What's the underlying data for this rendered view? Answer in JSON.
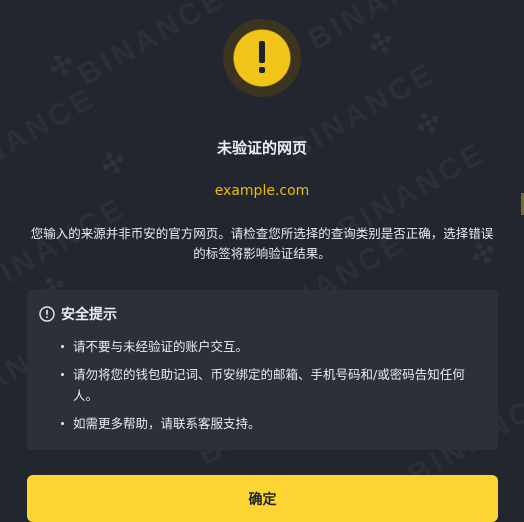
{
  "dialog": {
    "title": "未验证的网页",
    "domain": "example.com",
    "description": "您输入的来源并非币安的官方网页。请检查您所选择的查询类别是否正确，选择错误的标签将影响验证结果。",
    "tips": {
      "heading": "安全提示",
      "items": [
        "请不要与未经验证的账户交互。",
        "请勿将您的钱包助记词、币安绑定的邮箱、手机号码和/或密码告知任何人。",
        "如需更多帮助，请联系客服支持。"
      ]
    },
    "confirm_label": "确定"
  },
  "watermark": {
    "brand": "BINANCE"
  },
  "colors": {
    "background": "#22262e",
    "accent": "#f0b90b",
    "button": "#fcd535",
    "text": "#eaecef",
    "panel": "#2b3039"
  },
  "icons": {
    "alert": "exclamation-circle-icon",
    "info": "info-circle-icon"
  }
}
